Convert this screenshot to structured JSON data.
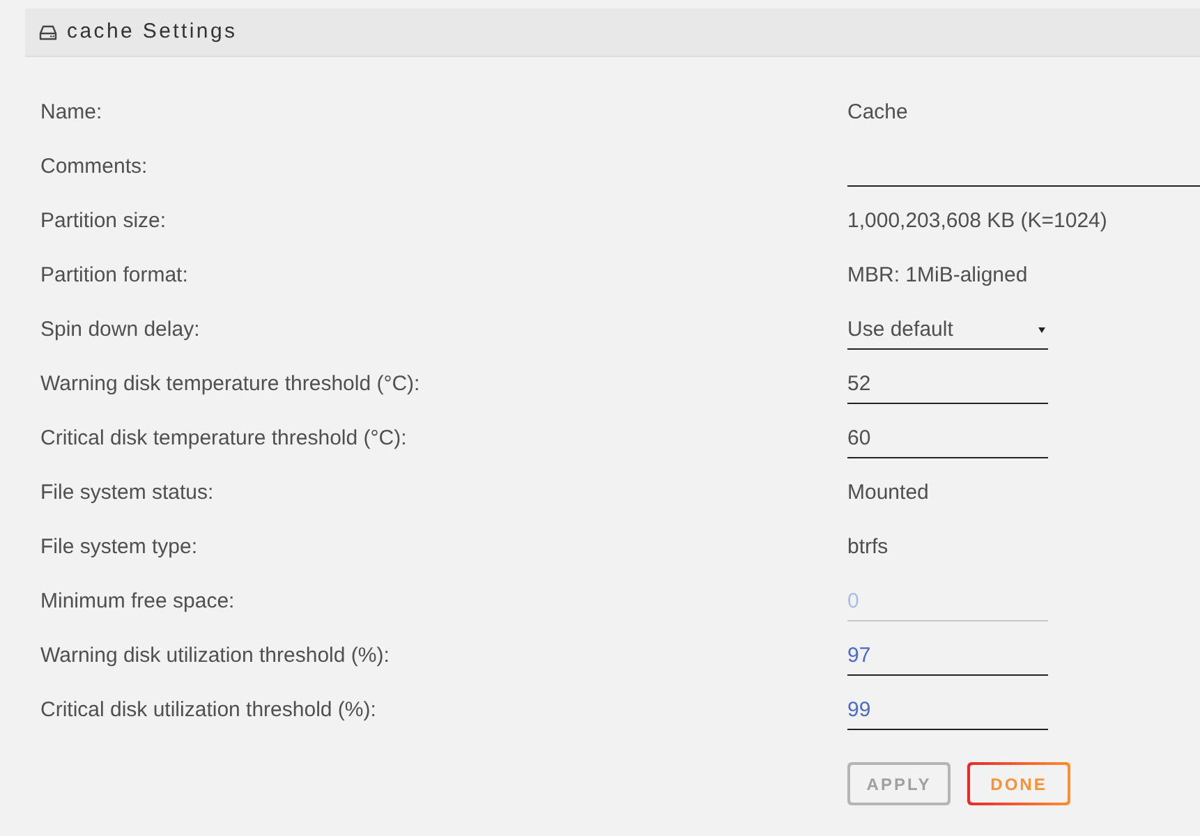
{
  "header": {
    "title": "cache Settings"
  },
  "rows": [
    {
      "label": "Name:",
      "kind": "static",
      "value": "Cache",
      "disabled": false
    },
    {
      "label": "Comments:",
      "kind": "wide_input",
      "disabled": false
    },
    {
      "label": "Partition size:",
      "kind": "static",
      "value": "1,000,203,608 KB (K=1024)",
      "disabled": false
    },
    {
      "label": "Partition format:",
      "kind": "static",
      "value": "MBR: 1MiB-aligned",
      "disabled": false
    },
    {
      "label": "Spin down delay:",
      "kind": "select",
      "value": "Use default",
      "disabled": false
    },
    {
      "label": "Warning disk temperature threshold (°C):",
      "kind": "input",
      "value": "52",
      "disabled": false
    },
    {
      "label": "Critical disk temperature threshold (°C):",
      "kind": "input",
      "value": "60",
      "disabled": false
    },
    {
      "label": "File system status:",
      "kind": "static",
      "value": "Mounted",
      "disabled": false
    },
    {
      "label": "File system type:",
      "kind": "static",
      "value": "btrfs",
      "disabled": false
    },
    {
      "label": "Minimum free space:",
      "kind": "numeric_input",
      "value": "0",
      "disabled": true
    },
    {
      "label": "Warning disk utilization threshold (%):",
      "kind": "numeric_input",
      "value": "97",
      "disabled": false
    },
    {
      "label": "Critical disk utilization threshold (%):",
      "kind": "numeric_input",
      "value": "99",
      "disabled": false
    }
  ],
  "buttons": [
    {
      "label": "APPLY",
      "disabled": true
    },
    {
      "label": "DONE",
      "disabled": false
    }
  ]
}
